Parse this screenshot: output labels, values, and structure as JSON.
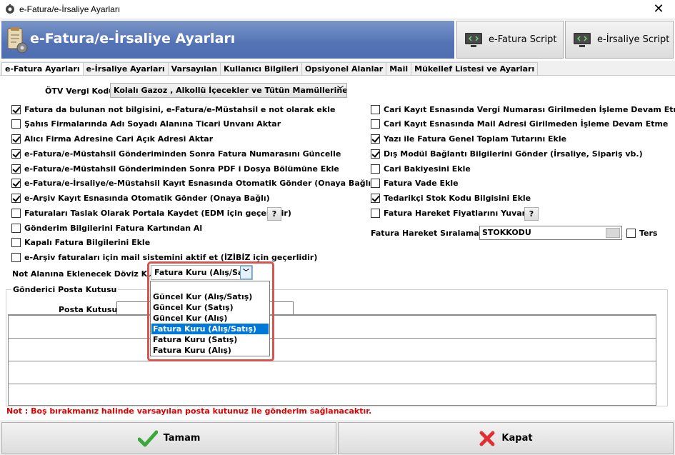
{
  "window": {
    "title": "e-Fatura/e-İrsaliye Ayarları",
    "close_glyph": "✕"
  },
  "banner": {
    "title": "e-Fatura/e-İrsaliye Ayarları",
    "efatura_script_label": "e-Fatura Script",
    "eirsaliye_script_label": "e-İrsaliye Script"
  },
  "tabs": [
    {
      "label": "e-Fatura Ayarları",
      "active": true
    },
    {
      "label": "e-İrsaliye Ayarları",
      "active": false
    },
    {
      "label": "Varsayılan",
      "active": false
    },
    {
      "label": "Kullanıcı Bilgileri",
      "active": false
    },
    {
      "label": "Opsiyonel Alanlar",
      "active": false
    },
    {
      "label": "Mail",
      "active": false
    },
    {
      "label": "Mükellef Listesi ve Ayarları",
      "active": false
    }
  ],
  "otv": {
    "label": "ÖTV Vergi Kodu",
    "value": "Kolalı Gazoz , Alkollü İçecekler ve Tütün Mamüllerine İl"
  },
  "left_checks": [
    {
      "label": "Fatura da bulunan not bilgisini, e-Fatura/e-Müstahsil e not olarak ekle",
      "checked": true
    },
    {
      "label": "Şahıs Firmalarında Adı Soyadı Alanına Ticari Unvanı Aktar",
      "checked": false
    },
    {
      "label": "Alıcı Firma Adresine Cari Açık Adresi Aktar",
      "checked": true
    },
    {
      "label": "e-Fatura/e-Müstahsil Gönderiminden Sonra Fatura Numarasını Güncelle",
      "checked": true
    },
    {
      "label": "e-Fatura/e-Müstahsil Gönderiminden Sonra PDF i Dosya Bölümüne Ekle",
      "checked": true
    },
    {
      "label": "e-Fatura/e-İrsaliye/e-Müstahsil Kayıt Esnasında Otomatik Gönder (Onaya Bağlı)",
      "checked": true
    },
    {
      "label": "e-Arşiv Kayıt Esnasında Otomatik Gönder (Onaya Bağlı)",
      "checked": true
    },
    {
      "label": "Faturaları Taslak Olarak Portala Kaydet (EDM için geçerlidir)",
      "checked": false
    },
    {
      "label": "Gönderim Bilgilerini Fatura Kartından Al",
      "checked": false
    },
    {
      "label": "Kapalı Fatura Bilgilerini Ekle",
      "checked": false
    },
    {
      "label": "e-Arşiv faturaları için mail sistemini aktif et (İZİBİZ için geçerlidir)",
      "checked": false
    }
  ],
  "right_checks": [
    {
      "label": "Cari Kayıt Esnasında Vergi Numarası Girilmeden İşleme Devam Etme",
      "checked": false
    },
    {
      "label": "Cari Kayıt Esnasında Mail Adresi Girilmeden İşleme Devam Etme",
      "checked": false
    },
    {
      "label": "Yazı ile Fatura Genel Toplam Tutarını Ekle",
      "checked": true
    },
    {
      "label": "Dış Modül Bağlantı Bilgilerini Gönder (İrsaliye, Sipariş vb.)",
      "checked": true
    },
    {
      "label": "Cari Bakiyesini Ekle",
      "checked": false
    },
    {
      "label": "Fatura Vade Ekle",
      "checked": false
    },
    {
      "label": "Tedarikçi Stok Kodu Bilgisini Ekle",
      "checked": true
    },
    {
      "label": "Fatura Hareket Fiyatlarını Yuvarla",
      "checked": false
    }
  ],
  "help_label": "?",
  "siralama": {
    "label": "Fatura Hareket Sıralaması",
    "value": "STOKKODU",
    "ters_label": "Ters",
    "ters_checked": false
  },
  "doviz": {
    "label": "Not Alanına Eklenecek Döviz Kuru",
    "value": "Fatura Kuru (Alış/Sat",
    "options": [
      "Güncel Kur (Alış/Satış)",
      "Güncel Kur (Satış)",
      "Güncel Kur (Alış)",
      "Fatura Kuru (Alış/Satış)",
      "Fatura Kuru (Satış)",
      "Fatura Kuru (Alış)"
    ],
    "selected_index": 3
  },
  "posta": {
    "group_label": "Gönderici Posta Kutusu",
    "field_label": "Posta Kutusu",
    "value": ""
  },
  "note": "Not : Boş bırakmanız halinde varsayılan posta kutunuz ile gönderim sağlanacaktır.",
  "buttons": {
    "ok_label": "Tamam",
    "cancel_label": "Kapat"
  },
  "colors": {
    "banner": "#5473b5",
    "selection": "#0078d7",
    "note": "#e00000",
    "highlight": "#d9534f"
  }
}
